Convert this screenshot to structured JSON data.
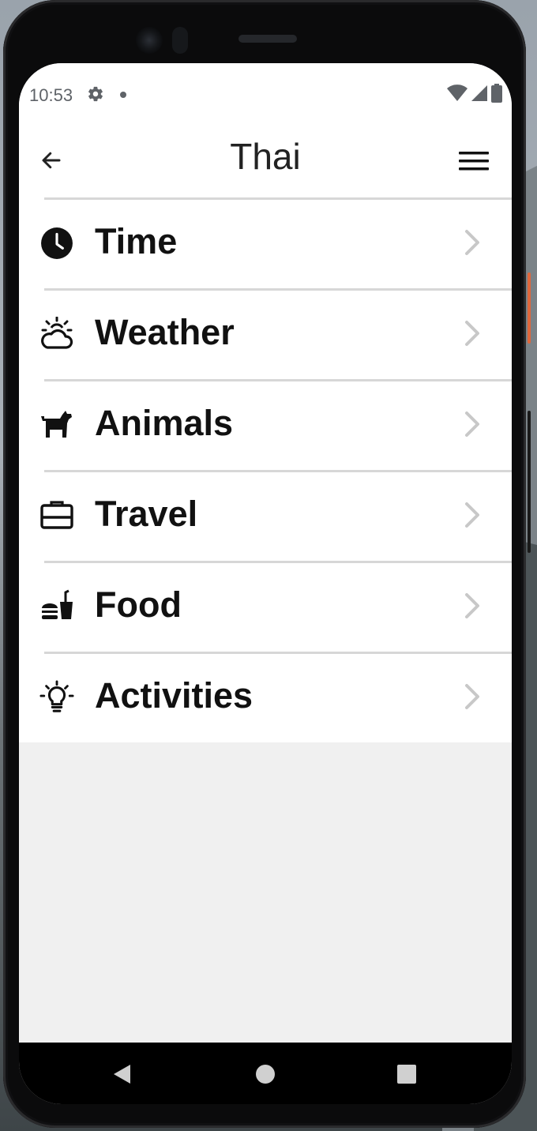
{
  "status_bar": {
    "time": "10:53",
    "icons": [
      "settings-gear-icon",
      "notification-dot-icon",
      "wifi-icon",
      "cellular-signal-icon",
      "battery-icon"
    ]
  },
  "app_bar": {
    "title": "Thai",
    "back_icon": "arrow-left-icon",
    "menu_icon": "hamburger-menu-icon"
  },
  "categories": [
    {
      "label": "Time",
      "icon": "clock-icon"
    },
    {
      "label": "Weather",
      "icon": "weather-cloud-sun-icon"
    },
    {
      "label": "Animals",
      "icon": "dog-icon"
    },
    {
      "label": "Travel",
      "icon": "suitcase-icon"
    },
    {
      "label": "Food",
      "icon": "fast-food-icon"
    },
    {
      "label": "Activities",
      "icon": "lightbulb-icon"
    }
  ],
  "nav_bar": {
    "icons": [
      "nav-back-icon",
      "nav-home-icon",
      "nav-recents-icon"
    ]
  },
  "colors": {
    "title_text": "#222222",
    "row_text": "#111111",
    "divider": "#d7d7d7",
    "chevron": "#c8c8c8",
    "empty_area": "#f0f0f0",
    "status_text": "#5f6368"
  }
}
